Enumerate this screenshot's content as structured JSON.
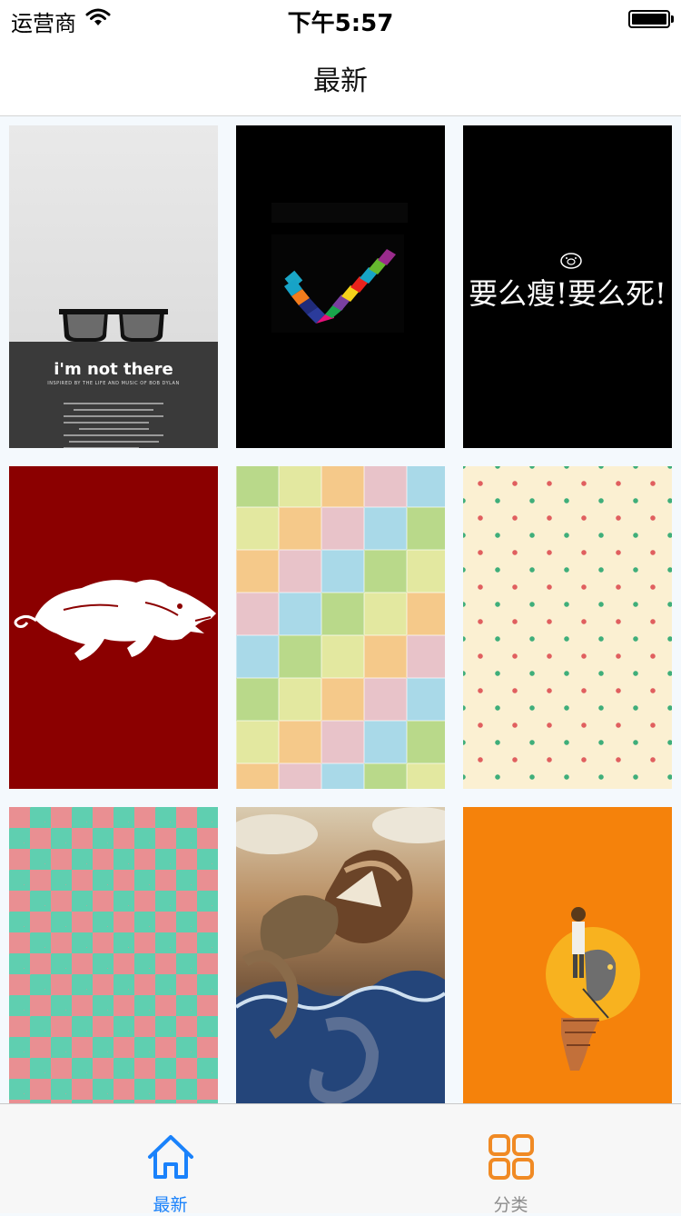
{
  "status_bar": {
    "carrier": "运营商",
    "time": "下午5:57",
    "battery": 1.0
  },
  "nav": {
    "title": "最新"
  },
  "wallpapers": [
    {
      "caption": "i'm not there",
      "subcaption": "INSPIRED BY THE LIFE AND MUSIC OF BOB DYLAN"
    },
    {
      "caption": ""
    },
    {
      "caption": "要么瘦!要么死!"
    },
    {
      "caption": ""
    },
    {
      "caption": ""
    },
    {
      "caption": ""
    },
    {
      "caption": ""
    },
    {
      "caption": ""
    },
    {
      "caption": ""
    }
  ],
  "tab_bar": {
    "tabs": [
      {
        "label": "最新",
        "icon": "home-icon",
        "selected": true
      },
      {
        "label": "分类",
        "icon": "grid-icon",
        "selected": false
      }
    ],
    "active_color": "#1a82fb",
    "inactive_icon_color": "#f08a24",
    "inactive_label_color": "#8e8e8e"
  }
}
